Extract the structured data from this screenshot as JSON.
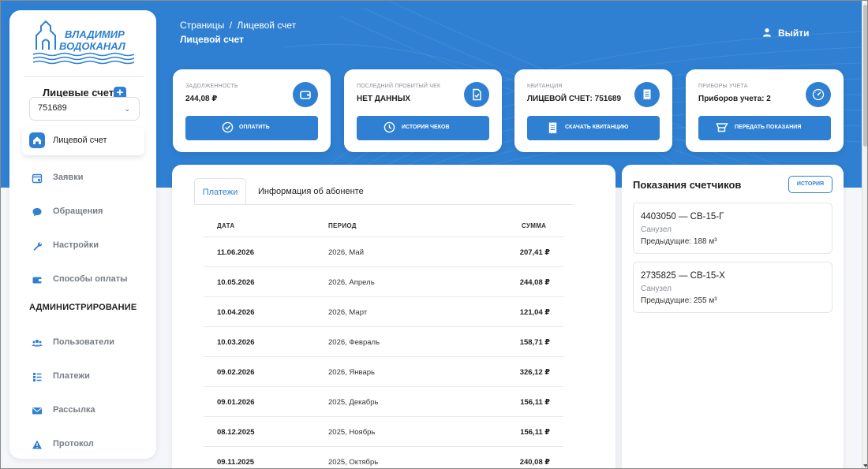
{
  "logo": {
    "line1": "ВЛАДИМИР",
    "line2": "ВОДОКАНАЛ"
  },
  "sidebar": {
    "accounts_title": "Лицевые счета",
    "account_selected": "751689",
    "active_item": "Лицевой счет",
    "items": [
      {
        "label": "Заявки",
        "icon": "calendar-icon"
      },
      {
        "label": "Обращения",
        "icon": "chat-icon"
      },
      {
        "label": "Настройки",
        "icon": "wrench-icon"
      },
      {
        "label": "Способы оплаты",
        "icon": "wallet-icon"
      }
    ],
    "admin_title": "АДМИНИСТРИРОВАНИЕ",
    "admin_items": [
      {
        "label": "Пользователи",
        "icon": "users-icon"
      },
      {
        "label": "Платежи",
        "icon": "list-icon"
      },
      {
        "label": "Рассылка",
        "icon": "mail-icon"
      },
      {
        "label": "Протокол",
        "icon": "warning-icon"
      }
    ]
  },
  "header": {
    "breadcrumb_root": "Страницы",
    "breadcrumb_sep": "/",
    "breadcrumb_current": "Лицевой счет",
    "title": "Лицевой счет",
    "logout": "Выйти"
  },
  "cards": [
    {
      "label": "ЗАДОЛЖЕННОСТЬ",
      "value": "244,08 ₽",
      "button": "ОПЛАТИТЬ",
      "icon": "wallet-icon"
    },
    {
      "label": "ПОСЛЕДНИЙ ПРОБИТЫЙ ЧЕК",
      "value": "НЕТ ДАННЫХ",
      "button": "ИСТОРИЯ ЧЕКОВ",
      "icon": "check-doc-icon"
    },
    {
      "label": "КВИТАНЦИЯ",
      "value": "ЛИЦЕВОЙ СЧЕТ: 751689",
      "button": "СКАЧАТЬ КВИТАНЦИЮ",
      "icon": "receipt-icon"
    },
    {
      "label": "ПРИБОРЫ УЧЕТА",
      "value": "Приборов учета: 2",
      "button": "ПЕРЕДАТЬ ПОКАЗАНИЯ",
      "icon": "gauge-icon"
    }
  ],
  "payments": {
    "tabs": [
      "Платежи",
      "Информация об абоненте"
    ],
    "columns": [
      "ДАТА",
      "ПЕРИОД",
      "СУММА"
    ],
    "rows": [
      {
        "date": "11.06.2026",
        "period": "2026, Май",
        "sum": "207,41 ₽"
      },
      {
        "date": "10.05.2026",
        "period": "2026, Апрель",
        "sum": "244,08 ₽"
      },
      {
        "date": "10.04.2026",
        "period": "2026, Март",
        "sum": "121,04 ₽"
      },
      {
        "date": "10.03.2026",
        "period": "2026, Февраль",
        "sum": "158,71 ₽"
      },
      {
        "date": "09.02.2026",
        "period": "2026, Январь",
        "sum": "326,12 ₽"
      },
      {
        "date": "09.01.2026",
        "period": "2025, Декабрь",
        "sum": "156,11 ₽"
      },
      {
        "date": "08.12.2025",
        "period": "2025, Ноябрь",
        "sum": "156,11 ₽"
      },
      {
        "date": "09.11.2025",
        "period": "2025, Октябрь",
        "sum": "240,08 ₽"
      }
    ]
  },
  "meters": {
    "title": "Показания счетчиков",
    "history_button": "ИСТОРИЯ",
    "items": [
      {
        "name": "4403050 — СВ-15-Г",
        "location": "Санузел",
        "previous": "Предыдущие: 188 м³"
      },
      {
        "name": "2735825 — СВ-15-Х",
        "location": "Санузел",
        "previous": "Предыдущие: 255 м³"
      }
    ]
  },
  "colors": {
    "accent": "#2f80d2",
    "hero": "#2f80d2"
  }
}
